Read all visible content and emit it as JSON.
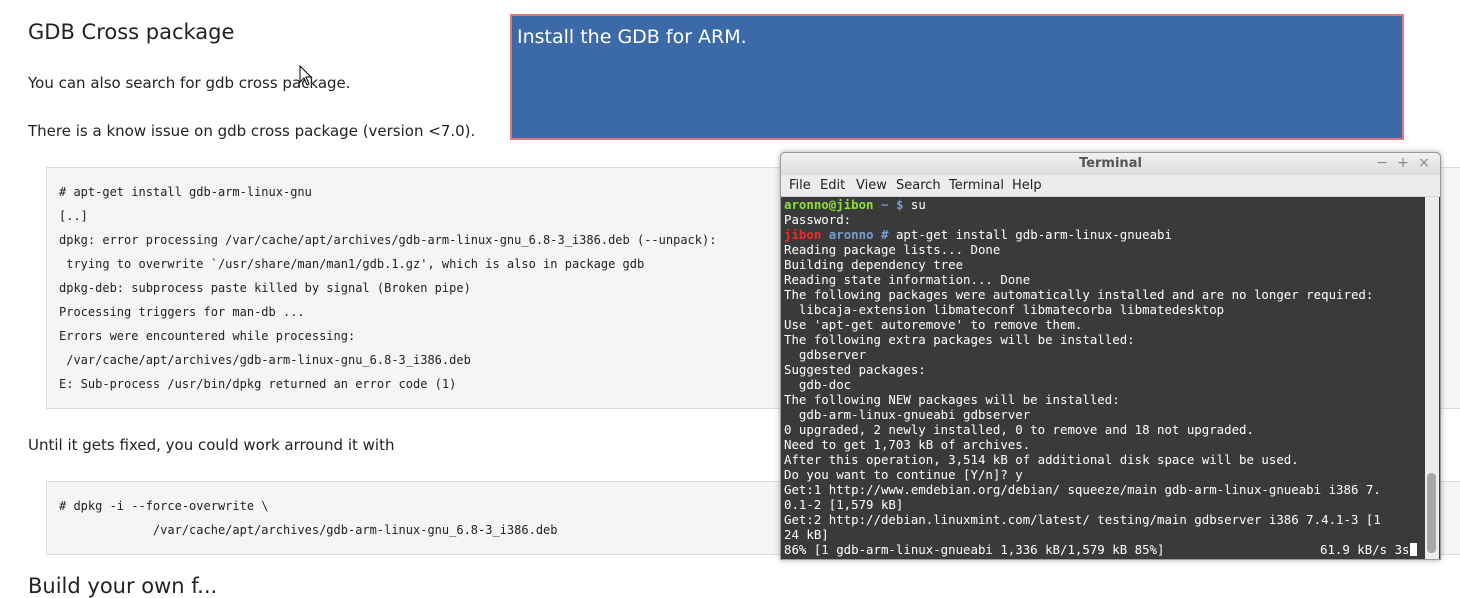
{
  "document": {
    "heading": "GDB Cross package",
    "para1": "You can also search for gdb cross package.",
    "para2": "There is a know issue on gdb cross package (version <7.0).",
    "code1": [
      "# apt-get install gdb-arm-linux-gnu",
      "[..]",
      "dpkg: error processing /var/cache/apt/archives/gdb-arm-linux-gnu_6.8-3_i386.deb (--unpack):",
      " trying to overwrite `/usr/share/man/man1/gdb.1.gz', which is also in package gdb",
      "dpkg-deb: subprocess paste killed by signal (Broken pipe)",
      "Processing triggers for man-db ...",
      "Errors were encountered while processing:",
      " /var/cache/apt/archives/gdb-arm-linux-gnu_6.8-3_i386.deb",
      "E: Sub-process /usr/bin/dpkg returned an error code (1)"
    ],
    "para3": "Until it gets fixed, you could work arround it with",
    "code2": [
      "# dpkg -i --force-overwrite \\",
      "             /var/cache/apt/archives/gdb-arm-linux-gnu_6.8-3_i386.deb"
    ],
    "next_heading_partial": "Build your own f..."
  },
  "banner": {
    "text": "Install the GDB for ARM."
  },
  "terminal": {
    "title": "Terminal",
    "menu": [
      "File",
      "Edit",
      "View",
      "Search",
      "Terminal",
      "Help"
    ],
    "prompt1": {
      "user": "aronno@jibon",
      "path": "~",
      "symbol": "$",
      "cmd": "su"
    },
    "line_password": "Password:",
    "prompt2": {
      "host": "jibon",
      "path": "aronno",
      "symbol": "#",
      "cmd": "apt-get install gdb-arm-linux-gnueabi"
    },
    "output": [
      "Reading package lists... Done",
      "Building dependency tree",
      "Reading state information... Done",
      "The following packages were automatically installed and are no longer required:",
      "  libcaja-extension libmateconf libmatecorba libmatedesktop",
      "Use 'apt-get autoremove' to remove them.",
      "The following extra packages will be installed:",
      "  gdbserver",
      "Suggested packages:",
      "  gdb-doc",
      "The following NEW packages will be installed:",
      "  gdb-arm-linux-gnueabi gdbserver",
      "0 upgraded, 2 newly installed, 0 to remove and 18 not upgraded.",
      "Need to get 1,703 kB of archives.",
      "After this operation, 3,514 kB of additional disk space will be used.",
      "Do you want to continue [Y/n]? y",
      "Get:1 http://www.emdebian.org/debian/ squeeze/main gdb-arm-linux-gnueabi i386 7.",
      "0.1-2 [1,579 kB]",
      "Get:2 http://debian.linuxmint.com/latest/ testing/main gdbserver i386 7.4.1-3 [1",
      "24 kB]"
    ],
    "progress_left": "86% [1 gdb-arm-linux-gnueabi 1,336 kB/1,579 kB 85%]",
    "progress_right": "61.9 kB/s 3s"
  }
}
